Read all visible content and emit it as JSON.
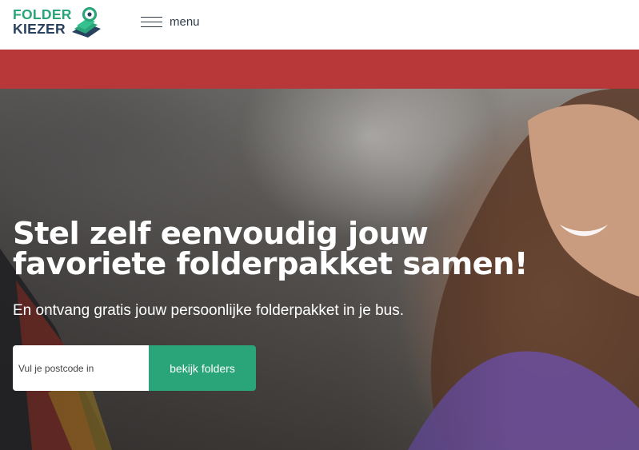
{
  "header": {
    "logo": {
      "line1": "FOLDER",
      "line2": "KIEZER"
    },
    "menu_label": "menu"
  },
  "hero": {
    "title": "Stel zelf eenvoudig jouw favoriete folderpakket samen!",
    "subtitle": "En ontvang gratis jouw persoonlijke folderpakket in je bus.",
    "search": {
      "placeholder": "Vul je postcode in",
      "value": "",
      "button_label": "bekijk folders"
    }
  },
  "colors": {
    "brand_green": "#2aa57a",
    "brand_navy": "#27415f",
    "band_red": "#b8383a"
  },
  "icons": {
    "menu": "hamburger-icon",
    "logo": "map-pin-folders-icon"
  }
}
